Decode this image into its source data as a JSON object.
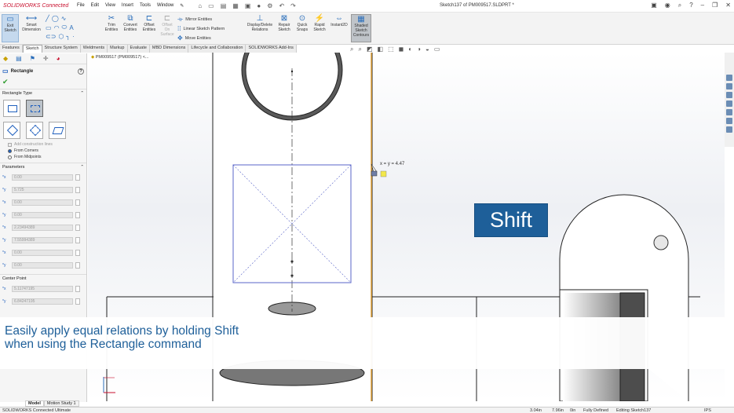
{
  "app": {
    "logo": "SOLIDWORKS",
    "logo_suffix": "Connected",
    "title": "Sketch137 of PM009517.SLDPRT *",
    "menu": [
      "File",
      "Edit",
      "View",
      "Insert",
      "Tools",
      "Window"
    ]
  },
  "ribbon": {
    "exit_sketch": "Exit Sketch",
    "smart_dimension": "Smart Dimension",
    "trim_entities": "Trim Entities",
    "convert_entities": "Convert Entities",
    "offset_entities": "Offset Entities",
    "offset_on_surface": "Offset On Surface",
    "mirror_entities": "Mirror Entities",
    "linear_sketch_pattern": "Linear Sketch Pattern",
    "move_entities": "Move Entities",
    "display_delete_relations": "Display/Delete Relations",
    "repair_sketch": "Repair Sketch",
    "quick_snaps": "Quick Snaps",
    "rapid_sketch": "Rapid Sketch",
    "instant2d": "Instant2D",
    "shaded_sketch_contours": "Shaded Sketch Contours"
  },
  "tabs": [
    "Features",
    "Sketch",
    "Structure System",
    "Weldments",
    "Markup",
    "Evaluate",
    "MBD Dimensions",
    "Lifecycle and Collaboration",
    "SOLIDWORKS Add-Ins"
  ],
  "property_manager": {
    "title": "Rectangle",
    "rect_type_label": "Rectangle Type",
    "add_construction": "Add construction lines",
    "from_corners": "From Corners",
    "from_midpoints": "From Midpoints",
    "parameters_label": "Parameters",
    "params": [
      "0.00",
      "5.725",
      "0.00",
      "0.00",
      "2.23494389",
      "7.55994389",
      "0.00",
      "0.00"
    ],
    "center_point_label": "Center Point",
    "center": [
      "5.11747195",
      "6.84247195"
    ]
  },
  "tree": {
    "part": "PM009517 (PM009517) <..."
  },
  "viewport": {
    "cursor_readout": "x = y = 4.47",
    "key_overlay": "Shift",
    "caption_line1": "Easily apply equal relations by holding Shift",
    "caption_line2": "when using the Rectangle command"
  },
  "model_tabs": [
    "Model",
    "Motion Study 1"
  ],
  "status": {
    "product": "SOLIDWORKS Connected Ultimate",
    "x": "3.04in",
    "y": "7.96in",
    "z": "0in",
    "state": "Fully Defined",
    "editing": "Editing Sketch137",
    "units": "IPS"
  },
  "colors": {
    "accent": "#1e5f99",
    "sketch": "#1f5fbd",
    "brand": "#c8102e"
  }
}
